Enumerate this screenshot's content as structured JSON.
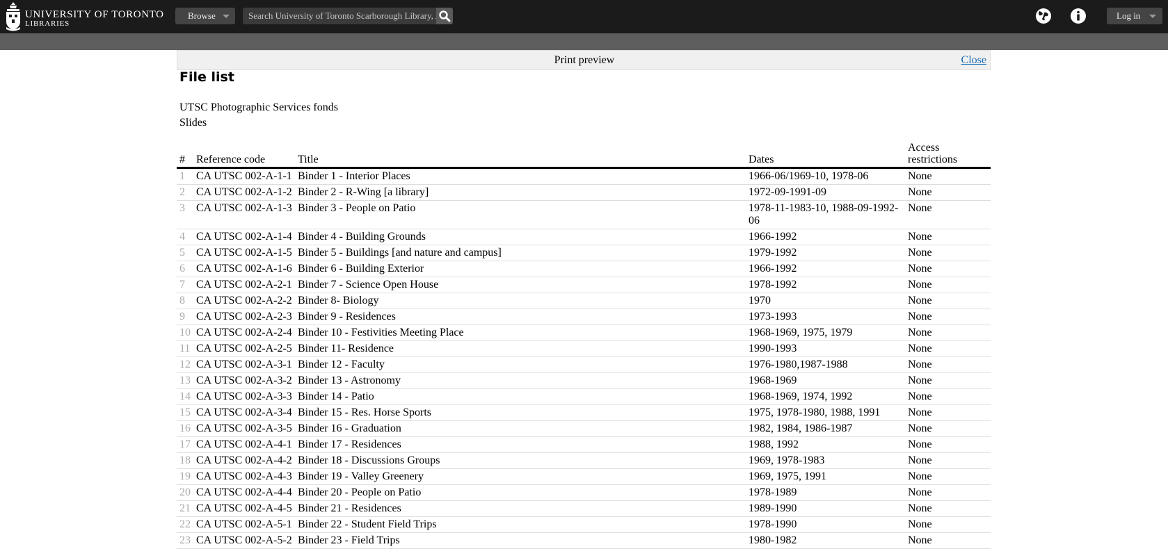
{
  "header": {
    "logo_line1": "UNIVERSITY OF TORONTO",
    "logo_line2": "LIBRARIES",
    "browse_label": "Browse",
    "search_placeholder": "Search University of Toronto Scarborough Library, Archives & Special Collections",
    "login_label": "Log in",
    "icons": [
      "crest-icon",
      "chevron-down-icon",
      "search-icon",
      "globe-icon",
      "info-icon"
    ]
  },
  "preview": {
    "title": "Print preview",
    "close_label": "Close"
  },
  "page": {
    "heading": "File list",
    "fonds": "UTSC Photographic Services fonds",
    "series": "Slides"
  },
  "table": {
    "columns": [
      "#",
      "Reference code",
      "Title",
      "Dates",
      "Access restrictions"
    ],
    "rows": [
      {
        "n": "1",
        "ref": "CA UTSC 002-A-1-1",
        "title": "Binder 1 - Interior Places",
        "dates": "1966-06/1969-10, 1978-06",
        "access": "None"
      },
      {
        "n": "2",
        "ref": "CA UTSC 002-A-1-2",
        "title": "Binder 2 - R-Wing [a library]",
        "dates": "1972-09-1991-09",
        "access": "None"
      },
      {
        "n": "3",
        "ref": "CA UTSC 002-A-1-3",
        "title": "Binder 3 - People on Patio",
        "dates": "1978-11-1983-10, 1988-09-1992-06",
        "access": "None"
      },
      {
        "n": "4",
        "ref": "CA UTSC 002-A-1-4",
        "title": "Binder 4 - Building Grounds",
        "dates": "1966-1992",
        "access": "None"
      },
      {
        "n": "5",
        "ref": "CA UTSC 002-A-1-5",
        "title": "Binder 5 - Buildings [and nature and campus]",
        "dates": "1979-1992",
        "access": "None"
      },
      {
        "n": "6",
        "ref": "CA UTSC 002-A-1-6",
        "title": "Binder 6 - Building Exterior",
        "dates": "1966-1992",
        "access": "None"
      },
      {
        "n": "7",
        "ref": "CA UTSC 002-A-2-1",
        "title": "Binder 7 - Science Open House",
        "dates": "1978-1992",
        "access": "None"
      },
      {
        "n": "8",
        "ref": "CA UTSC 002-A-2-2",
        "title": "Binder 8- Biology",
        "dates": "1970",
        "access": "None"
      },
      {
        "n": "9",
        "ref": "CA UTSC 002-A-2-3",
        "title": "Binder 9 - Residences",
        "dates": "1973-1993",
        "access": "None"
      },
      {
        "n": "10",
        "ref": "CA UTSC 002-A-2-4",
        "title": "Binder 10 - Festivities Meeting Place",
        "dates": "1968-1969, 1975, 1979",
        "access": "None"
      },
      {
        "n": "11",
        "ref": "CA UTSC 002-A-2-5",
        "title": "Binder 11- Residence",
        "dates": "1990-1993",
        "access": "None"
      },
      {
        "n": "12",
        "ref": "CA UTSC 002-A-3-1",
        "title": "Binder 12 - Faculty",
        "dates": "1976-1980,1987-1988",
        "access": "None"
      },
      {
        "n": "13",
        "ref": "CA UTSC 002-A-3-2",
        "title": "Binder 13 - Astronomy",
        "dates": "1968-1969",
        "access": "None"
      },
      {
        "n": "14",
        "ref": "CA UTSC 002-A-3-3",
        "title": "Binder 14 - Patio",
        "dates": "1968-1969, 1974, 1992",
        "access": "None"
      },
      {
        "n": "15",
        "ref": "CA UTSC 002-A-3-4",
        "title": "Binder 15 - Res. Horse Sports",
        "dates": "1975, 1978-1980, 1988, 1991",
        "access": "None"
      },
      {
        "n": "16",
        "ref": "CA UTSC 002-A-3-5",
        "title": "Binder 16 - Graduation",
        "dates": "1982, 1984, 1986-1987",
        "access": "None"
      },
      {
        "n": "17",
        "ref": "CA UTSC 002-A-4-1",
        "title": "Binder 17 - Residences",
        "dates": "1988, 1992",
        "access": "None"
      },
      {
        "n": "18",
        "ref": "CA UTSC 002-A-4-2",
        "title": "Binder 18 - Discussions Groups",
        "dates": "1969, 1978-1983",
        "access": "None"
      },
      {
        "n": "19",
        "ref": "CA UTSC 002-A-4-3",
        "title": "Binder 19 - Valley Greenery",
        "dates": "1969, 1975, 1991",
        "access": "None"
      },
      {
        "n": "20",
        "ref": "CA UTSC 002-A-4-4",
        "title": "Binder 20 - People on Patio",
        "dates": "1978-1989",
        "access": "None"
      },
      {
        "n": "21",
        "ref": "CA UTSC 002-A-4-5",
        "title": "Binder 21 - Residences",
        "dates": "1989-1990",
        "access": "None"
      },
      {
        "n": "22",
        "ref": "CA UTSC 002-A-5-1",
        "title": "Binder 22 - Student Field Trips",
        "dates": "1978-1990",
        "access": "None"
      },
      {
        "n": "23",
        "ref": "CA UTSC 002-A-5-2",
        "title": "Binder 23 - Field Trips",
        "dates": "1980-1982",
        "access": "None"
      }
    ]
  }
}
